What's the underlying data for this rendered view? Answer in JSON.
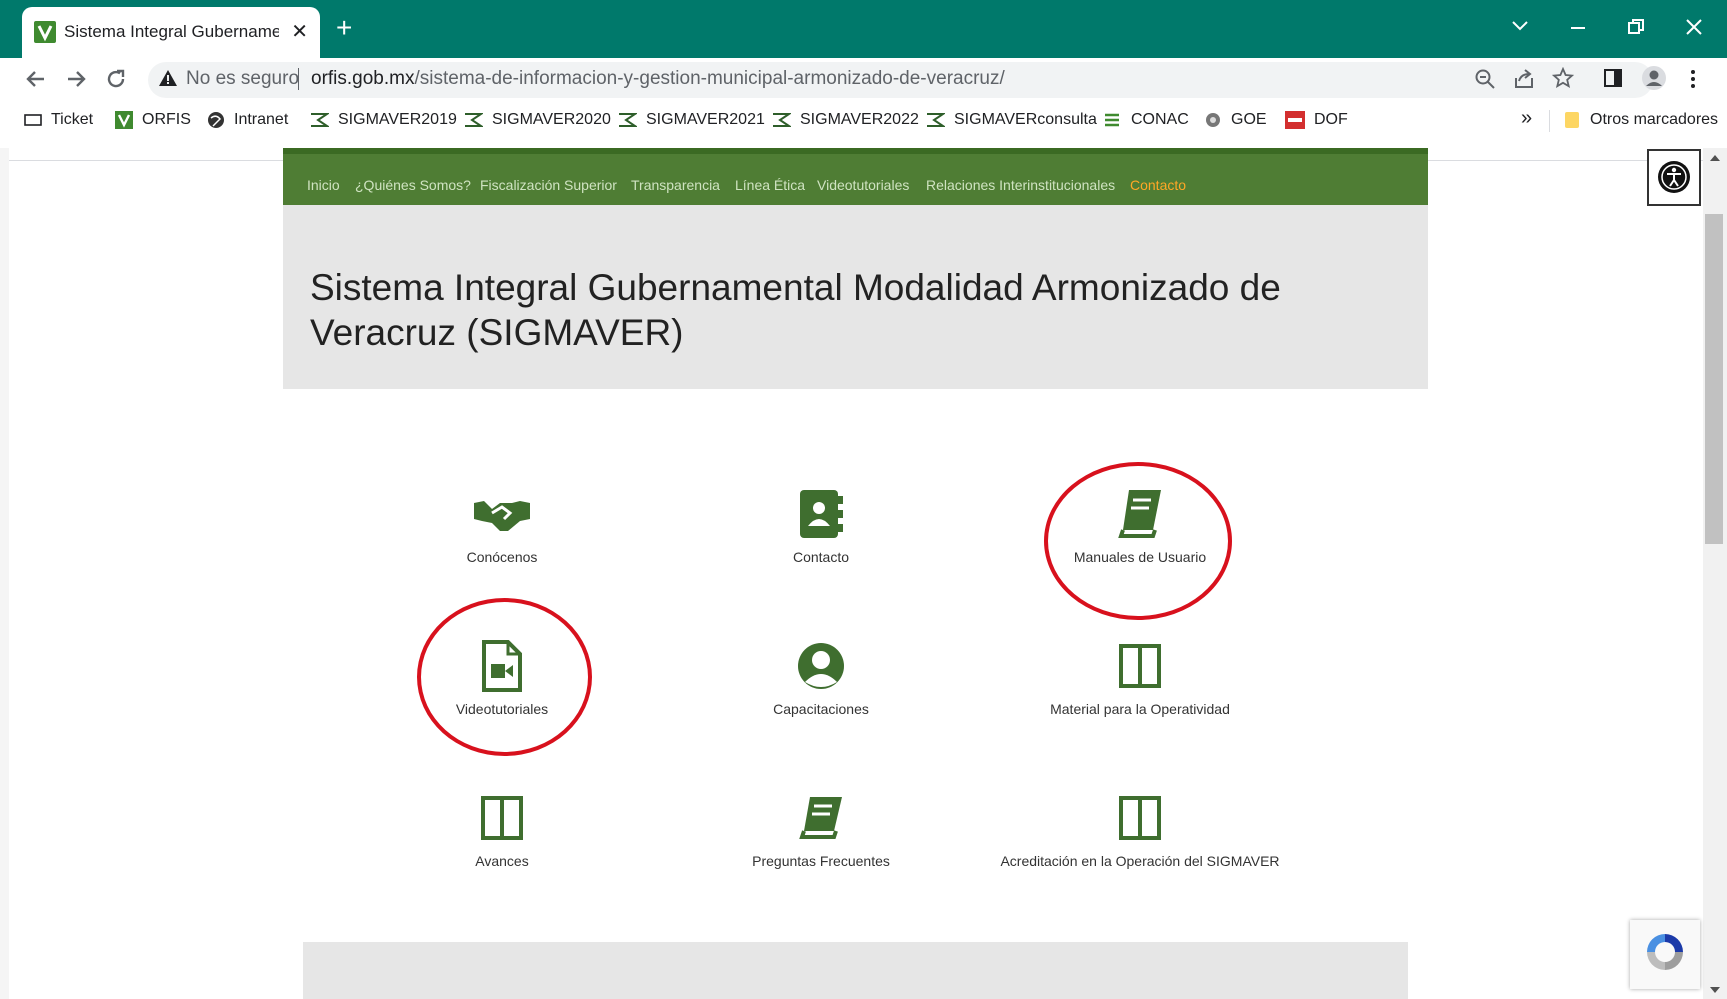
{
  "browser": {
    "tab_title": "Sistema Integral Gubernamental",
    "new_tab": "+",
    "tab_close": "✕",
    "security_label": "No es seguro",
    "url_host": "orfis.gob.mx",
    "url_path": "/sistema-de-informacion-y-gestion-municipal-armonizado-de-veracruz/",
    "bookmarks": [
      {
        "label": "Ticket",
        "icon": "ticket-icon"
      },
      {
        "label": "ORFIS",
        "icon": "orfis-logo-icon"
      },
      {
        "label": "Intranet",
        "icon": "globe-icon"
      },
      {
        "label": "SIGMAVER2019",
        "icon": "sigmaver-icon"
      },
      {
        "label": "SIGMAVER2020",
        "icon": "sigmaver-icon"
      },
      {
        "label": "SIGMAVER2021",
        "icon": "sigmaver-icon"
      },
      {
        "label": "SIGMAVER2022",
        "icon": "sigmaver-icon"
      },
      {
        "label": "SIGMAVERconsulta",
        "icon": "sigmaver-icon"
      },
      {
        "label": "CONAC",
        "icon": "conac-icon"
      },
      {
        "label": "GOE",
        "icon": "goe-icon"
      },
      {
        "label": "DOF",
        "icon": "dof-icon"
      }
    ],
    "bookmarks_more": "»",
    "other_bookmarks": "Otros marcadores"
  },
  "site": {
    "menu": [
      "Inicio",
      "¿Quiénes Somos?",
      "Fiscalización Superior",
      "Transparencia",
      "Línea Ética",
      "Videotutoriales",
      "Relaciones Interinstitucionales",
      "Contacto"
    ],
    "active_menu": "Contacto",
    "title": "Sistema Integral Gubernamental Modalidad Armonizado de Veracruz (SIGMAVER)",
    "tiles": [
      {
        "label": "Conócenos",
        "icon": "handshake-icon"
      },
      {
        "label": "Contacto",
        "icon": "address-book-icon"
      },
      {
        "label": "Manuales de Usuario",
        "icon": "book-icon"
      },
      {
        "label": "Videotutoriales",
        "icon": "video-file-icon"
      },
      {
        "label": "Capacitaciones",
        "icon": "user-circle-icon"
      },
      {
        "label": "Material para la Operatividad",
        "icon": "columns-icon"
      },
      {
        "label": "Avances",
        "icon": "columns-icon"
      },
      {
        "label": "Preguntas Frecuentes",
        "icon": "book-icon"
      },
      {
        "label": "Acreditación en la Operación del SIGMAVER",
        "icon": "columns-icon"
      }
    ]
  },
  "colors": {
    "tabbar": "#00796b",
    "menu_bar": "#4f7d34",
    "icon_green": "#3f6e2f",
    "annotation_red": "#d8111d",
    "active_menu": "#ffa726"
  }
}
